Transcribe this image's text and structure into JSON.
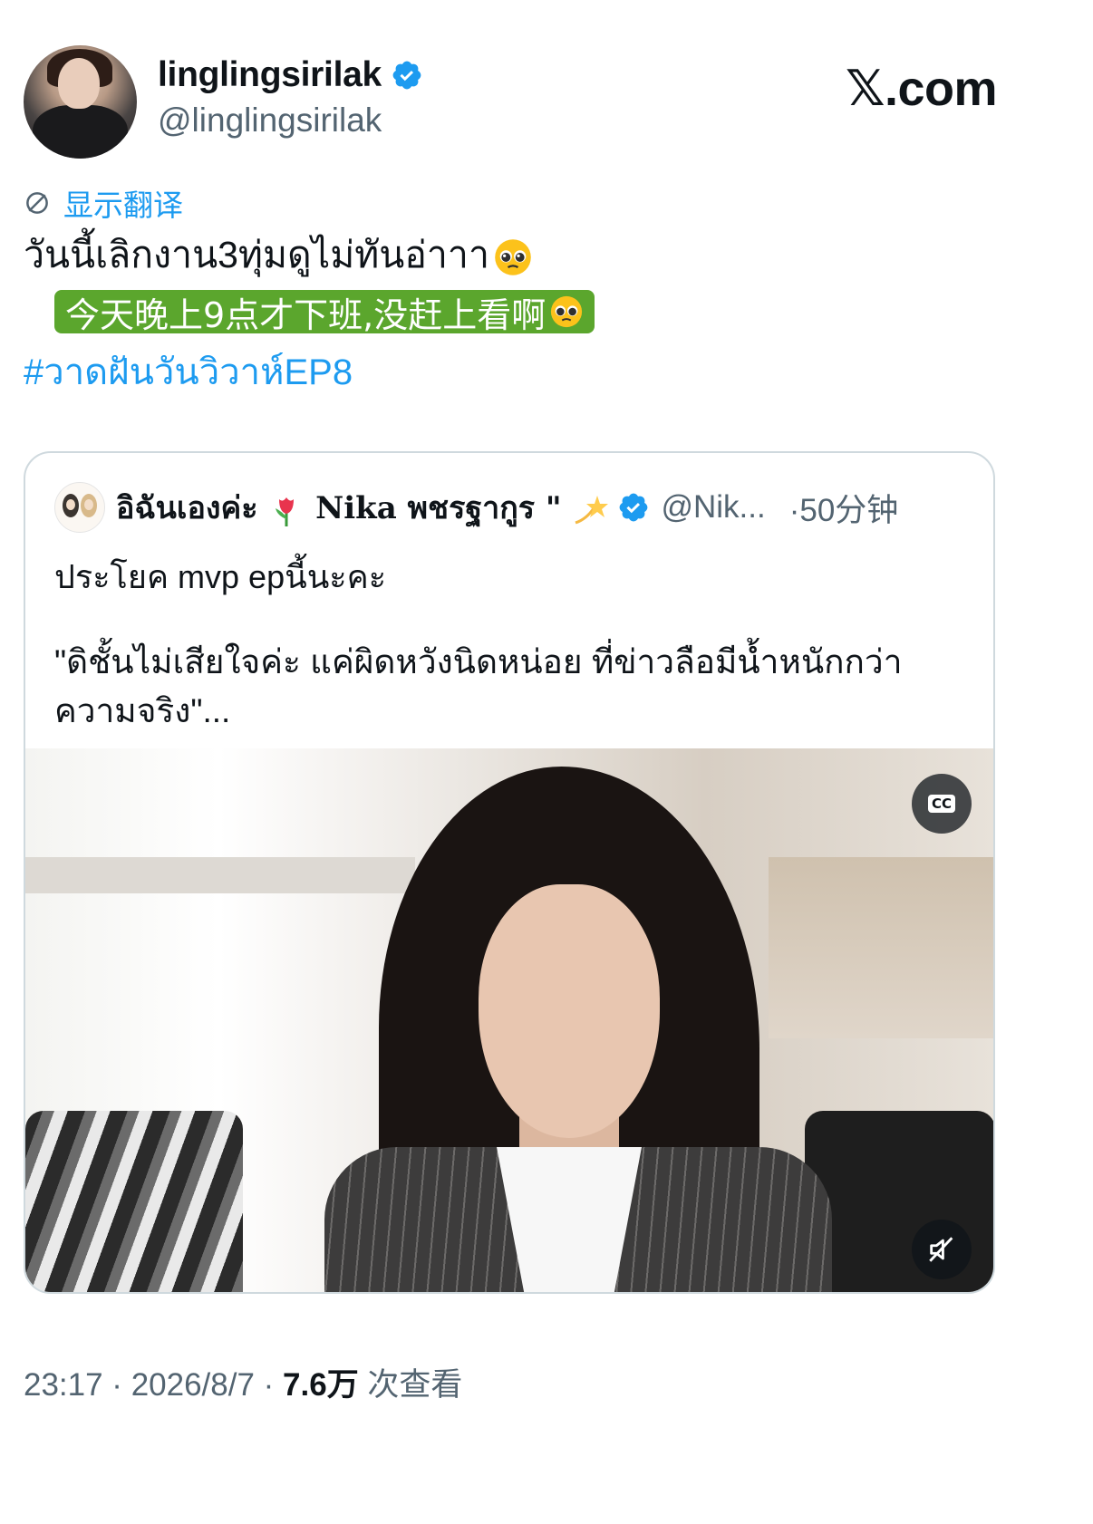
{
  "author": {
    "display_name": "linglingsirilak",
    "handle": "@linglingsirilak",
    "verified": true
  },
  "brand": "𝕏.com",
  "translate_label": "显示翻译",
  "tweet": {
    "text": "วันนี้เลิกงาน3ทุ่มดูไม่ทันอ่าาา",
    "emoji": "pleading-face",
    "translation_overlay": "今天晚上9点才下班,没赶上看啊",
    "hashtag": "#วาดฝันวันวิวาห์EP8"
  },
  "quoted_tweet": {
    "name_part1": "อิฉันเองค่ะ",
    "name_emoji1": "tulip",
    "name_part2": "Nika พชรฐากูร \"",
    "name_emoji2": "dizzy",
    "verified": true,
    "handle": "@Nik...",
    "time": "·50分钟",
    "text_line1": "ประโยค mvp epนี้นะคะ",
    "text_quote": "\"ดิชั้นไม่เสียใจค่ะ แค่ผิดหวังนิดหน่อย ที่ข่าวลือมีน้ำหนักกว่าความจริง\"...",
    "video": {
      "cc_label": "CC",
      "muted": true
    }
  },
  "footer": {
    "time": "23:17 · 2026/8/7 · ",
    "views_count": "7.6万",
    "views_label": " 次查看"
  },
  "colors": {
    "link_blue": "#1d9bf0",
    "secondary_text": "#536471",
    "translation_highlight": "#5ba62d"
  }
}
